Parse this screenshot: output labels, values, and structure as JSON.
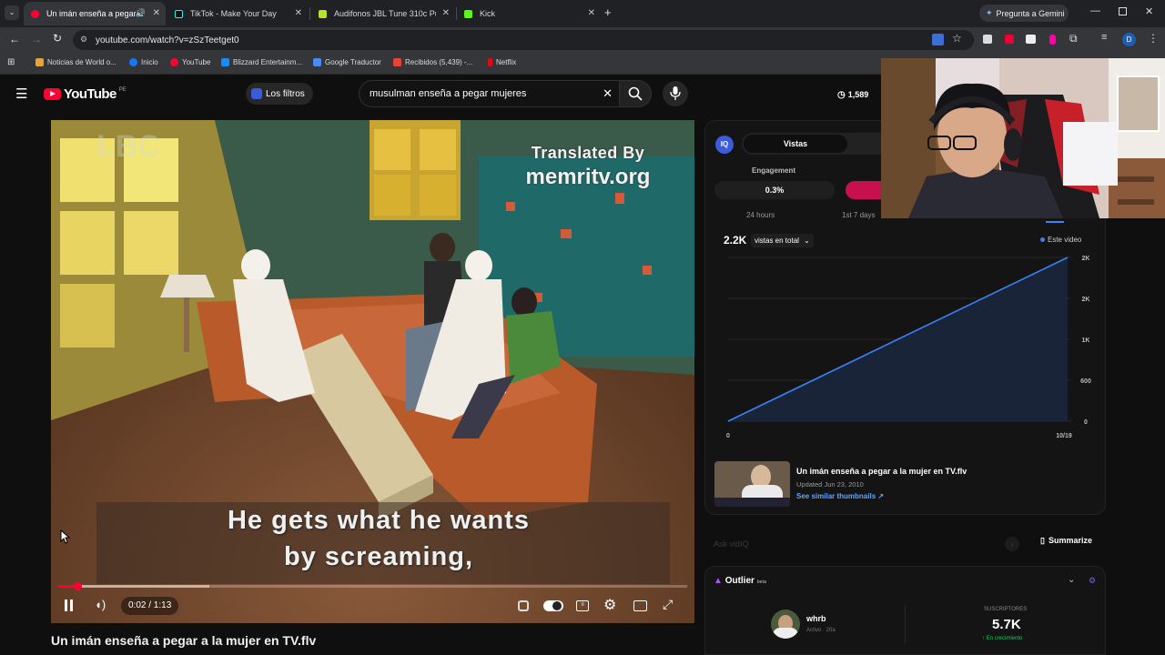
{
  "browser": {
    "tabs": [
      {
        "title": "Un imán enseña a pegar a",
        "active": true,
        "color": "#ff0033"
      },
      {
        "title": "TikTok - Make Your Day",
        "active": false,
        "color": "#111111"
      },
      {
        "title": "Audifonos JBL Tune 310c Pure",
        "active": false,
        "color": "#b3e32b"
      },
      {
        "title": "Kick",
        "active": false,
        "color": "#53fc18"
      }
    ],
    "gemini_label": "Pregunta a Gemini",
    "url": "youtube.com/watch?v=zSzTeetget0",
    "profile_initial": "D",
    "bookmarks": [
      {
        "label": "Noticias de World o...",
        "color": "#e8a33a"
      },
      {
        "label": "Inicio",
        "color": "#1877f2"
      },
      {
        "label": "YouTube",
        "color": "#ff0033"
      },
      {
        "label": "Blizzard Entertainm...",
        "color": "#148eff"
      },
      {
        "label": "Google Traductor",
        "color": "#4a8af4"
      },
      {
        "label": "Recibidos (5,439) -...",
        "color": "#ea4335"
      },
      {
        "label": "Netflix",
        "color": "#e50914"
      }
    ]
  },
  "youtube": {
    "logo_text": "YouTube",
    "region": "PE",
    "filters_label": "Los filtros",
    "search_value": "musulman enseña a pegar mujeres",
    "header_count": "1,589",
    "video": {
      "watermark_top": "Translated By",
      "watermark_site": "memritv.org",
      "subtitle_line1": "He gets what he wants",
      "subtitle_line2": "by screaming,",
      "time": "0:02 / 1:13",
      "progress": 0.03,
      "buffered": 0.24,
      "title": "Un imán enseña a pegar a la mujer en TV.flv"
    }
  },
  "iq_panel": {
    "tab_active": "Vistas",
    "engagement_label": "Engagement",
    "engagement_value": "0.3%",
    "period_24h": "24 hours",
    "period_7d": "1st 7 days",
    "total_views": "2.2K",
    "views_dropdown": "vistas en total",
    "legend": "Este video",
    "summary_title": "Un imán enseña a pegar a la mujer en TV.flv",
    "summary_updated": "Updated Jun 23, 2010",
    "summary_link": "See similar thumbnails",
    "ask_placeholder": "Ask vidIQ",
    "summarize_label": "Summarize"
  },
  "chart_data": {
    "type": "line",
    "x_tick_labels": [
      "0",
      "10/19"
    ],
    "y_tick_labels": [
      "2K",
      "2K",
      "1K",
      "600",
      "0"
    ],
    "series": [
      {
        "x": [
          0,
          1
        ],
        "y": [
          0,
          2200
        ],
        "color": "#3b82f6"
      }
    ],
    "ylim": [
      0,
      2200
    ],
    "grid": true
  },
  "outlier": {
    "title": "Outlier",
    "beta": "beta",
    "channel_name": "whrb",
    "channel_status": "Activo · 20a",
    "subs_label": "SUSCRIPTORES",
    "subs_value": "5.7K",
    "subs_trend": "En crecimiento",
    "trend_color": "#22c55e"
  }
}
